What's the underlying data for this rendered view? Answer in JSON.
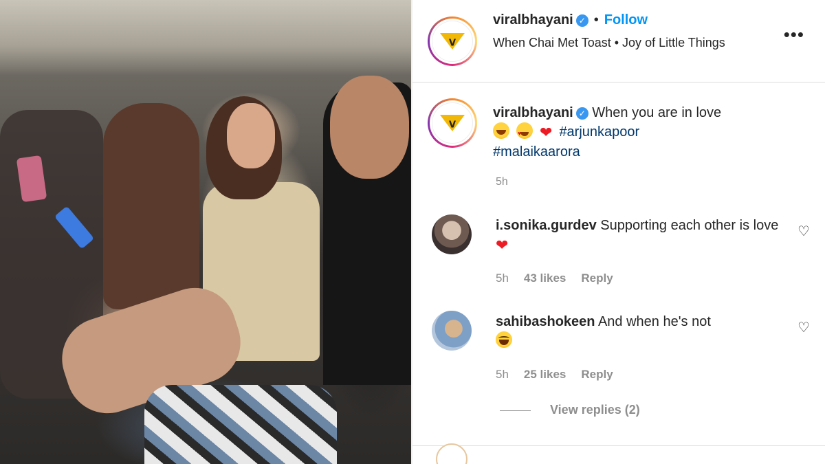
{
  "post": {
    "username": "viralbhayani",
    "follow_label": "Follow",
    "separator": "•",
    "subtitle": "When Chai Met Toast • Joy of Little Things",
    "more_label": "•••"
  },
  "caption": {
    "username": "viralbhayani",
    "text": "When you are in love",
    "hashtags": [
      "#arjunkapoor",
      "#malaikaarora"
    ],
    "time": "5h"
  },
  "comments": [
    {
      "username": "i.sonika.gurdev",
      "text": "Supporting each other is love",
      "time": "5h",
      "likes": "43 likes",
      "reply": "Reply"
    },
    {
      "username": "sahibashokeen",
      "text": "And when he's not",
      "time": "5h",
      "likes": "25 likes",
      "reply": "Reply"
    }
  ],
  "view_replies": "View replies (2)",
  "icons": {
    "verified": "verified-badge-icon",
    "more": "more-options-icon",
    "like": "heart-outline-icon"
  },
  "colors": {
    "follow": "#0095f6",
    "verified": "#3897f0",
    "hashtag": "#00376b",
    "muted": "#8e8e8e",
    "heart": "#ed1c24",
    "logo_yellow": "#f2b807"
  }
}
